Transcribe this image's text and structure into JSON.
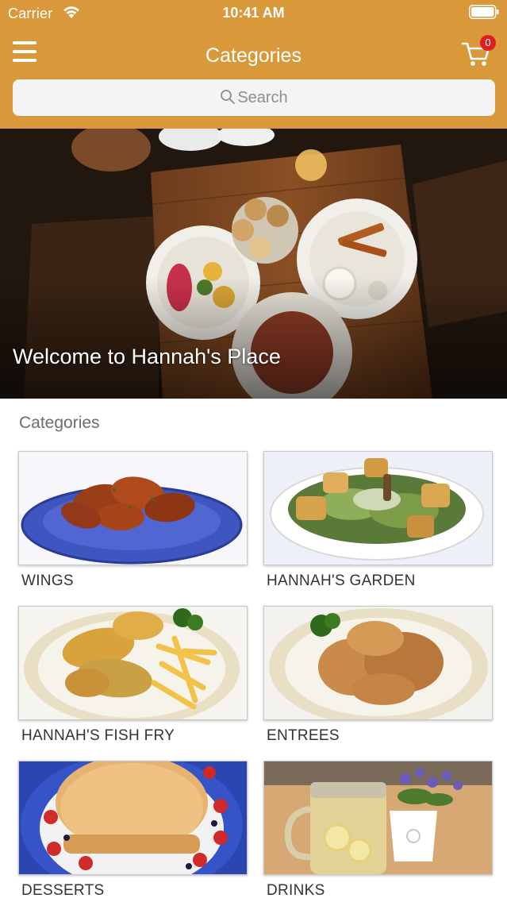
{
  "status_bar": {
    "carrier": "Carrier",
    "time": "10:41 AM"
  },
  "nav": {
    "title": "Categories",
    "cart_count": "0"
  },
  "search": {
    "placeholder": "Search"
  },
  "hero": {
    "title": "Welcome to Hannah's Place"
  },
  "categories": {
    "heading": "Categories",
    "items": [
      {
        "label": "WINGS"
      },
      {
        "label": "HANNAH'S GARDEN"
      },
      {
        "label": "HANNAH'S FISH FRY"
      },
      {
        "label": "ENTREES"
      },
      {
        "label": "DESSERTS"
      },
      {
        "label": "DRINKS"
      }
    ]
  },
  "colors": {
    "header": "#d9993a",
    "badge": "#e02020",
    "label": "#333333"
  }
}
